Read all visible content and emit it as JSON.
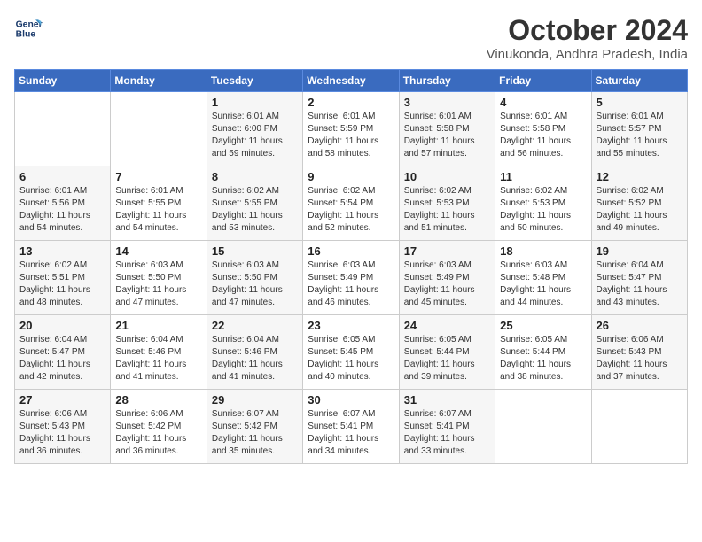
{
  "logo": {
    "line1": "General",
    "line2": "Blue"
  },
  "title": "October 2024",
  "location": "Vinukonda, Andhra Pradesh, India",
  "weekdays": [
    "Sunday",
    "Monday",
    "Tuesday",
    "Wednesday",
    "Thursday",
    "Friday",
    "Saturday"
  ],
  "weeks": [
    [
      {
        "num": "",
        "info": ""
      },
      {
        "num": "",
        "info": ""
      },
      {
        "num": "1",
        "info": "Sunrise: 6:01 AM\nSunset: 6:00 PM\nDaylight: 11 hours\nand 59 minutes."
      },
      {
        "num": "2",
        "info": "Sunrise: 6:01 AM\nSunset: 5:59 PM\nDaylight: 11 hours\nand 58 minutes."
      },
      {
        "num": "3",
        "info": "Sunrise: 6:01 AM\nSunset: 5:58 PM\nDaylight: 11 hours\nand 57 minutes."
      },
      {
        "num": "4",
        "info": "Sunrise: 6:01 AM\nSunset: 5:58 PM\nDaylight: 11 hours\nand 56 minutes."
      },
      {
        "num": "5",
        "info": "Sunrise: 6:01 AM\nSunset: 5:57 PM\nDaylight: 11 hours\nand 55 minutes."
      }
    ],
    [
      {
        "num": "6",
        "info": "Sunrise: 6:01 AM\nSunset: 5:56 PM\nDaylight: 11 hours\nand 54 minutes."
      },
      {
        "num": "7",
        "info": "Sunrise: 6:01 AM\nSunset: 5:55 PM\nDaylight: 11 hours\nand 54 minutes."
      },
      {
        "num": "8",
        "info": "Sunrise: 6:02 AM\nSunset: 5:55 PM\nDaylight: 11 hours\nand 53 minutes."
      },
      {
        "num": "9",
        "info": "Sunrise: 6:02 AM\nSunset: 5:54 PM\nDaylight: 11 hours\nand 52 minutes."
      },
      {
        "num": "10",
        "info": "Sunrise: 6:02 AM\nSunset: 5:53 PM\nDaylight: 11 hours\nand 51 minutes."
      },
      {
        "num": "11",
        "info": "Sunrise: 6:02 AM\nSunset: 5:53 PM\nDaylight: 11 hours\nand 50 minutes."
      },
      {
        "num": "12",
        "info": "Sunrise: 6:02 AM\nSunset: 5:52 PM\nDaylight: 11 hours\nand 49 minutes."
      }
    ],
    [
      {
        "num": "13",
        "info": "Sunrise: 6:02 AM\nSunset: 5:51 PM\nDaylight: 11 hours\nand 48 minutes."
      },
      {
        "num": "14",
        "info": "Sunrise: 6:03 AM\nSunset: 5:50 PM\nDaylight: 11 hours\nand 47 minutes."
      },
      {
        "num": "15",
        "info": "Sunrise: 6:03 AM\nSunset: 5:50 PM\nDaylight: 11 hours\nand 47 minutes."
      },
      {
        "num": "16",
        "info": "Sunrise: 6:03 AM\nSunset: 5:49 PM\nDaylight: 11 hours\nand 46 minutes."
      },
      {
        "num": "17",
        "info": "Sunrise: 6:03 AM\nSunset: 5:49 PM\nDaylight: 11 hours\nand 45 minutes."
      },
      {
        "num": "18",
        "info": "Sunrise: 6:03 AM\nSunset: 5:48 PM\nDaylight: 11 hours\nand 44 minutes."
      },
      {
        "num": "19",
        "info": "Sunrise: 6:04 AM\nSunset: 5:47 PM\nDaylight: 11 hours\nand 43 minutes."
      }
    ],
    [
      {
        "num": "20",
        "info": "Sunrise: 6:04 AM\nSunset: 5:47 PM\nDaylight: 11 hours\nand 42 minutes."
      },
      {
        "num": "21",
        "info": "Sunrise: 6:04 AM\nSunset: 5:46 PM\nDaylight: 11 hours\nand 41 minutes."
      },
      {
        "num": "22",
        "info": "Sunrise: 6:04 AM\nSunset: 5:46 PM\nDaylight: 11 hours\nand 41 minutes."
      },
      {
        "num": "23",
        "info": "Sunrise: 6:05 AM\nSunset: 5:45 PM\nDaylight: 11 hours\nand 40 minutes."
      },
      {
        "num": "24",
        "info": "Sunrise: 6:05 AM\nSunset: 5:44 PM\nDaylight: 11 hours\nand 39 minutes."
      },
      {
        "num": "25",
        "info": "Sunrise: 6:05 AM\nSunset: 5:44 PM\nDaylight: 11 hours\nand 38 minutes."
      },
      {
        "num": "26",
        "info": "Sunrise: 6:06 AM\nSunset: 5:43 PM\nDaylight: 11 hours\nand 37 minutes."
      }
    ],
    [
      {
        "num": "27",
        "info": "Sunrise: 6:06 AM\nSunset: 5:43 PM\nDaylight: 11 hours\nand 36 minutes."
      },
      {
        "num": "28",
        "info": "Sunrise: 6:06 AM\nSunset: 5:42 PM\nDaylight: 11 hours\nand 36 minutes."
      },
      {
        "num": "29",
        "info": "Sunrise: 6:07 AM\nSunset: 5:42 PM\nDaylight: 11 hours\nand 35 minutes."
      },
      {
        "num": "30",
        "info": "Sunrise: 6:07 AM\nSunset: 5:41 PM\nDaylight: 11 hours\nand 34 minutes."
      },
      {
        "num": "31",
        "info": "Sunrise: 6:07 AM\nSunset: 5:41 PM\nDaylight: 11 hours\nand 33 minutes."
      },
      {
        "num": "",
        "info": ""
      },
      {
        "num": "",
        "info": ""
      }
    ]
  ]
}
